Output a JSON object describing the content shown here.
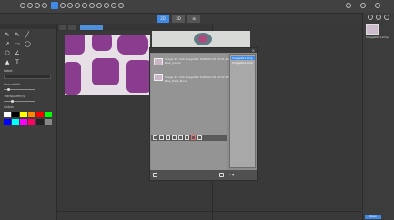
{
  "toolbar": {
    "icons": [
      "open-icon",
      "save-icon",
      "undo-icon",
      "redo-icon",
      "settings-icon",
      "info-icon",
      "zoom-in-icon",
      "zoom-out-icon",
      "fit-icon",
      "rotate-icon",
      "grid-icon",
      "ruler-icon",
      "layers-icon",
      "export-icon",
      "help-icon"
    ]
  },
  "viewbar": {
    "items": [
      "2D",
      "3D",
      "⊞"
    ]
  },
  "doc_tabs": {
    "tabs": [
      "",
      "",
      ""
    ]
  },
  "left_panel": {
    "label_annot": "Label",
    "label_line_width": "Line width",
    "label_transparency": "Transparency",
    "label_colors": "Colors",
    "swatch_colors": [
      "#ffffff",
      "#000000",
      "#ffff00",
      "#ff8800",
      "#ff0000",
      "#00ff00",
      "#0000ff",
      "#00ffff",
      "#ff00ff",
      "#ff0066",
      "#222222",
      "#888888"
    ]
  },
  "dialog": {
    "info1_line1": "Image #1 C00 Image001 2020-02-06 10:51:29",
    "info1_line2": "Blue_2.bmp",
    "info2_line1": "Image #1 C00 Image002 2020-02-06 10:52:08",
    "info2_line2": "Blue_Mark_None",
    "list_items": [
      "Image001.bmp",
      "Image002.bmp"
    ],
    "bottom_text": "1 ●"
  },
  "right_panel": {
    "thumb_label": "Image0001.bmp",
    "bottom_button": "Open"
  }
}
